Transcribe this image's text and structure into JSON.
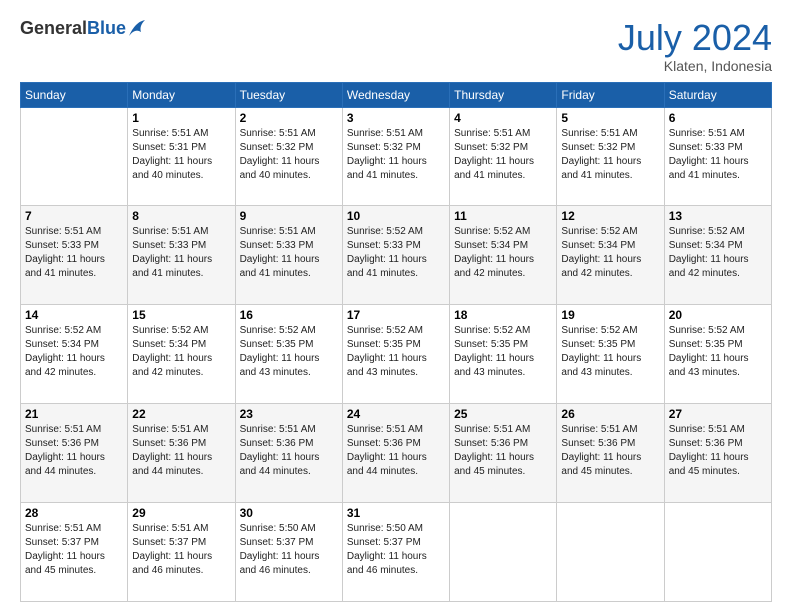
{
  "header": {
    "logo_general": "General",
    "logo_blue": "Blue",
    "month_title": "July 2024",
    "location": "Klaten, Indonesia"
  },
  "weekdays": [
    "Sunday",
    "Monday",
    "Tuesday",
    "Wednesday",
    "Thursday",
    "Friday",
    "Saturday"
  ],
  "weeks": [
    [
      {
        "day": "",
        "info": ""
      },
      {
        "day": "1",
        "info": "Sunrise: 5:51 AM\nSunset: 5:31 PM\nDaylight: 11 hours\nand 40 minutes."
      },
      {
        "day": "2",
        "info": "Sunrise: 5:51 AM\nSunset: 5:32 PM\nDaylight: 11 hours\nand 40 minutes."
      },
      {
        "day": "3",
        "info": "Sunrise: 5:51 AM\nSunset: 5:32 PM\nDaylight: 11 hours\nand 41 minutes."
      },
      {
        "day": "4",
        "info": "Sunrise: 5:51 AM\nSunset: 5:32 PM\nDaylight: 11 hours\nand 41 minutes."
      },
      {
        "day": "5",
        "info": "Sunrise: 5:51 AM\nSunset: 5:32 PM\nDaylight: 11 hours\nand 41 minutes."
      },
      {
        "day": "6",
        "info": "Sunrise: 5:51 AM\nSunset: 5:33 PM\nDaylight: 11 hours\nand 41 minutes."
      }
    ],
    [
      {
        "day": "7",
        "info": "Sunrise: 5:51 AM\nSunset: 5:33 PM\nDaylight: 11 hours\nand 41 minutes."
      },
      {
        "day": "8",
        "info": "Sunrise: 5:51 AM\nSunset: 5:33 PM\nDaylight: 11 hours\nand 41 minutes."
      },
      {
        "day": "9",
        "info": "Sunrise: 5:51 AM\nSunset: 5:33 PM\nDaylight: 11 hours\nand 41 minutes."
      },
      {
        "day": "10",
        "info": "Sunrise: 5:52 AM\nSunset: 5:33 PM\nDaylight: 11 hours\nand 41 minutes."
      },
      {
        "day": "11",
        "info": "Sunrise: 5:52 AM\nSunset: 5:34 PM\nDaylight: 11 hours\nand 42 minutes."
      },
      {
        "day": "12",
        "info": "Sunrise: 5:52 AM\nSunset: 5:34 PM\nDaylight: 11 hours\nand 42 minutes."
      },
      {
        "day": "13",
        "info": "Sunrise: 5:52 AM\nSunset: 5:34 PM\nDaylight: 11 hours\nand 42 minutes."
      }
    ],
    [
      {
        "day": "14",
        "info": "Sunrise: 5:52 AM\nSunset: 5:34 PM\nDaylight: 11 hours\nand 42 minutes."
      },
      {
        "day": "15",
        "info": "Sunrise: 5:52 AM\nSunset: 5:34 PM\nDaylight: 11 hours\nand 42 minutes."
      },
      {
        "day": "16",
        "info": "Sunrise: 5:52 AM\nSunset: 5:35 PM\nDaylight: 11 hours\nand 43 minutes."
      },
      {
        "day": "17",
        "info": "Sunrise: 5:52 AM\nSunset: 5:35 PM\nDaylight: 11 hours\nand 43 minutes."
      },
      {
        "day": "18",
        "info": "Sunrise: 5:52 AM\nSunset: 5:35 PM\nDaylight: 11 hours\nand 43 minutes."
      },
      {
        "day": "19",
        "info": "Sunrise: 5:52 AM\nSunset: 5:35 PM\nDaylight: 11 hours\nand 43 minutes."
      },
      {
        "day": "20",
        "info": "Sunrise: 5:52 AM\nSunset: 5:35 PM\nDaylight: 11 hours\nand 43 minutes."
      }
    ],
    [
      {
        "day": "21",
        "info": "Sunrise: 5:51 AM\nSunset: 5:36 PM\nDaylight: 11 hours\nand 44 minutes."
      },
      {
        "day": "22",
        "info": "Sunrise: 5:51 AM\nSunset: 5:36 PM\nDaylight: 11 hours\nand 44 minutes."
      },
      {
        "day": "23",
        "info": "Sunrise: 5:51 AM\nSunset: 5:36 PM\nDaylight: 11 hours\nand 44 minutes."
      },
      {
        "day": "24",
        "info": "Sunrise: 5:51 AM\nSunset: 5:36 PM\nDaylight: 11 hours\nand 44 minutes."
      },
      {
        "day": "25",
        "info": "Sunrise: 5:51 AM\nSunset: 5:36 PM\nDaylight: 11 hours\nand 45 minutes."
      },
      {
        "day": "26",
        "info": "Sunrise: 5:51 AM\nSunset: 5:36 PM\nDaylight: 11 hours\nand 45 minutes."
      },
      {
        "day": "27",
        "info": "Sunrise: 5:51 AM\nSunset: 5:36 PM\nDaylight: 11 hours\nand 45 minutes."
      }
    ],
    [
      {
        "day": "28",
        "info": "Sunrise: 5:51 AM\nSunset: 5:37 PM\nDaylight: 11 hours\nand 45 minutes."
      },
      {
        "day": "29",
        "info": "Sunrise: 5:51 AM\nSunset: 5:37 PM\nDaylight: 11 hours\nand 46 minutes."
      },
      {
        "day": "30",
        "info": "Sunrise: 5:50 AM\nSunset: 5:37 PM\nDaylight: 11 hours\nand 46 minutes."
      },
      {
        "day": "31",
        "info": "Sunrise: 5:50 AM\nSunset: 5:37 PM\nDaylight: 11 hours\nand 46 minutes."
      },
      {
        "day": "",
        "info": ""
      },
      {
        "day": "",
        "info": ""
      },
      {
        "day": "",
        "info": ""
      }
    ]
  ]
}
